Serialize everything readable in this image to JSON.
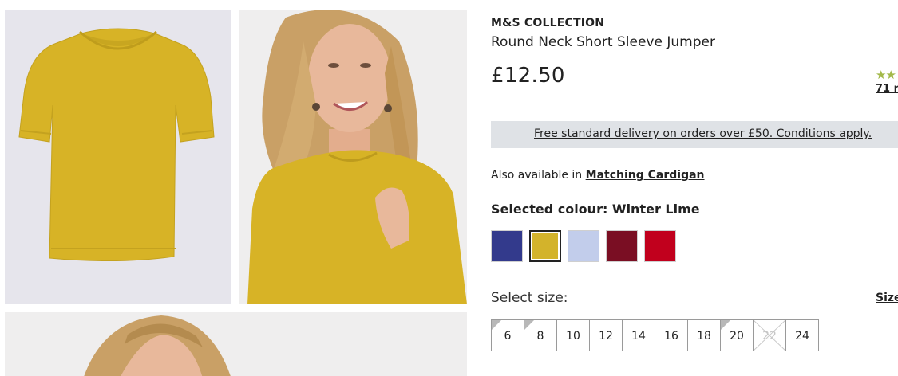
{
  "product": {
    "brand": "M&S COLLECTION",
    "title": "Round Neck Short Sleeve Jumper",
    "price": "£12.50",
    "rating_stars": "★★",
    "reviews_text": "71 r"
  },
  "delivery": {
    "text": "Free standard delivery on orders over £50. Conditions apply."
  },
  "also_available": {
    "prefix": "Also available in",
    "link": "Matching Cardigan"
  },
  "colour": {
    "label": "Selected colour: Winter Lime",
    "swatches": [
      {
        "name": "navy",
        "color": "#333a8c",
        "selected": false
      },
      {
        "name": "winter-lime",
        "color": "#d3b32b",
        "selected": true
      },
      {
        "name": "light-blue",
        "color": "#c2cdeb",
        "selected": false
      },
      {
        "name": "burgundy",
        "color": "#7a0e23",
        "selected": false
      },
      {
        "name": "red",
        "color": "#c1001d",
        "selected": false
      }
    ]
  },
  "size": {
    "label": "Select size:",
    "guide": "Size",
    "options": [
      {
        "label": "6",
        "corner": true,
        "available": true
      },
      {
        "label": "8",
        "corner": true,
        "available": true
      },
      {
        "label": "10",
        "corner": false,
        "available": true
      },
      {
        "label": "12",
        "corner": false,
        "available": true
      },
      {
        "label": "14",
        "corner": false,
        "available": true
      },
      {
        "label": "16",
        "corner": false,
        "available": true
      },
      {
        "label": "18",
        "corner": false,
        "available": true
      },
      {
        "label": "20",
        "corner": true,
        "available": true
      },
      {
        "label": "22",
        "corner": false,
        "available": false
      },
      {
        "label": "24",
        "corner": false,
        "available": true
      }
    ]
  },
  "gallery": {
    "garment_color": "#d7b326",
    "hair_color": "#c9a066",
    "skin_color": "#e8b89b"
  }
}
